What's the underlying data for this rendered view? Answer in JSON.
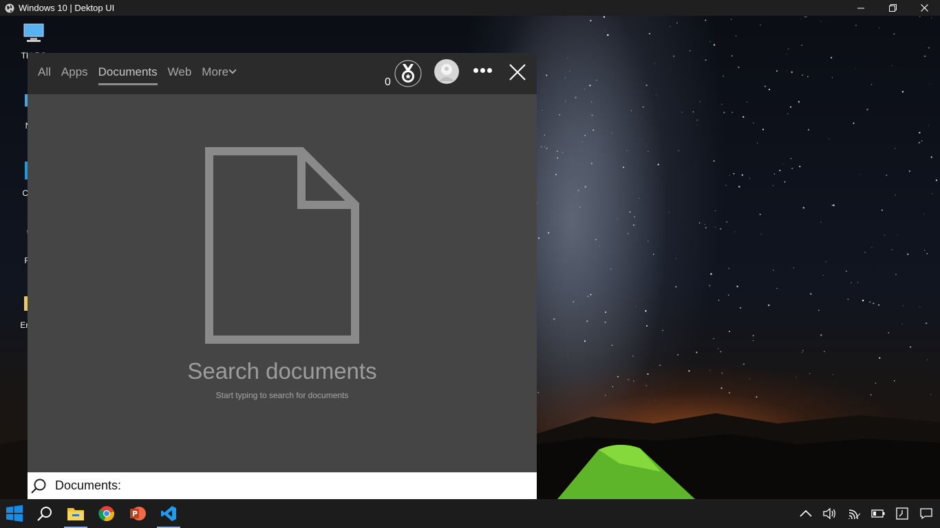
{
  "window": {
    "title": "Windows 10 | Dektop UI",
    "icon": "globe-icon",
    "controls": [
      "minimize-icon",
      "restore-icon",
      "close-icon"
    ]
  },
  "desktop": {
    "icons": [
      {
        "label": "Thi PC",
        "icon": "this-pc-icon"
      },
      {
        "label": "Netv",
        "icon": "network-icon"
      },
      {
        "label": "Co Pa",
        "icon": "control-panel-icon"
      },
      {
        "label": "Recy",
        "icon": "recycle-bin-icon"
      },
      {
        "label": "Eng So",
        "icon": "folder-icon"
      }
    ]
  },
  "search_panel": {
    "tabs": [
      {
        "label": "All",
        "active": false
      },
      {
        "label": "Apps",
        "active": false
      },
      {
        "label": "Documents",
        "active": true
      },
      {
        "label": "Web",
        "active": false
      },
      {
        "label": "More",
        "active": false
      }
    ],
    "points": "0",
    "empty_state": {
      "title": "Search documents",
      "subtitle": "Start typing to search for documents"
    },
    "search": {
      "prefix": "Documents:",
      "value": ""
    }
  },
  "taskbar": {
    "apps": [
      "windows-start-icon",
      "search-icon",
      "file-explorer-icon",
      "chrome-icon",
      "powerpoint-icon",
      "vscode-icon"
    ],
    "tray": [
      "chevron-up-icon",
      "volume-icon",
      "wifi-icon",
      "battery-icon",
      "clock-icon",
      "notification-icon"
    ]
  },
  "colors": {
    "panel_bg": "#454545",
    "panel_header_bg": "#2b2b2b",
    "taskbar_bg": "#1c1c1c",
    "accent": "#0078d7"
  }
}
